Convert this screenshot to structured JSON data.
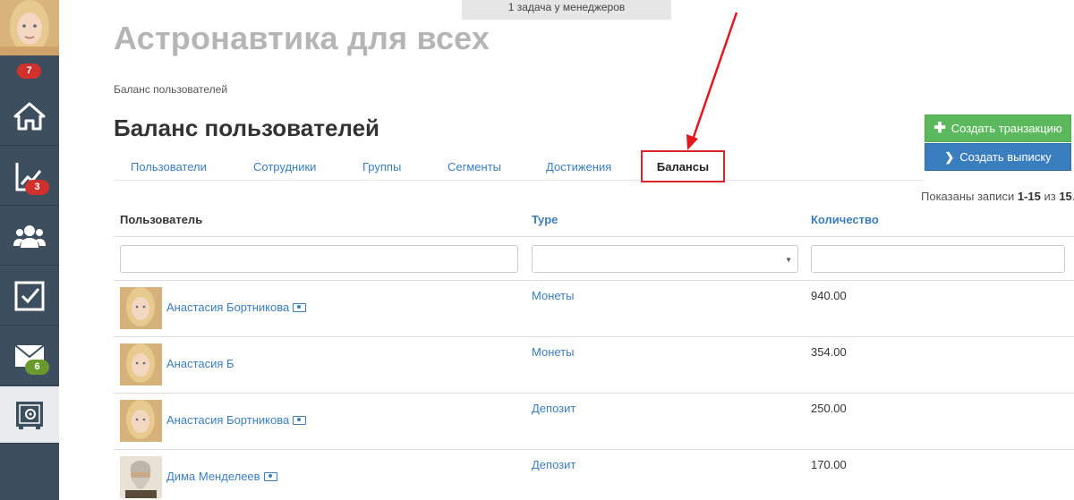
{
  "top_notice": "1 задача у менеджеров",
  "app_title": "Астронавтика для всех",
  "breadcrumb": "Баланс пользователей",
  "page_title": "Баланс пользователей",
  "sidebar": {
    "items": [
      {
        "icon": "home-icon"
      },
      {
        "icon": "chart-icon",
        "badge": "3"
      },
      {
        "icon": "users-icon"
      },
      {
        "icon": "checkbox-icon"
      },
      {
        "icon": "mail-icon",
        "badge": "6"
      },
      {
        "icon": "safe-icon"
      }
    ],
    "avatar_badge": "7"
  },
  "buttons": {
    "create_transaction": "Создать транзакцию",
    "create_statement": "Создать выписку"
  },
  "tabs": [
    "Пользователи",
    "Сотрудники",
    "Группы",
    "Сегменты",
    "Достижения",
    "Балансы"
  ],
  "active_tab": "Балансы",
  "records": {
    "prefix": "Показаны записи ",
    "range": "1-15",
    "mid": " из ",
    "total": "15",
    "suffix": "."
  },
  "table": {
    "columns": [
      "Пользователь",
      "Type",
      "Количество"
    ],
    "rows": [
      {
        "name": "Анастасия Бортникова",
        "cash_icon": true,
        "type": "Монеты",
        "amount": "940.00"
      },
      {
        "name": "Анастасия Б",
        "cash_icon": false,
        "type": "Монеты",
        "amount": "354.00"
      },
      {
        "name": "Анастасия Бортникова",
        "cash_icon": true,
        "type": "Депозит",
        "amount": "250.00"
      },
      {
        "name": "Дима Менделеев",
        "cash_icon": true,
        "type": "Депозит",
        "amount": "170.00"
      }
    ]
  },
  "colors": {
    "sidebar": "#3d4f5f",
    "accent": "#3a7ebf",
    "green": "#5cb85c",
    "highlight": "#d9262d"
  }
}
